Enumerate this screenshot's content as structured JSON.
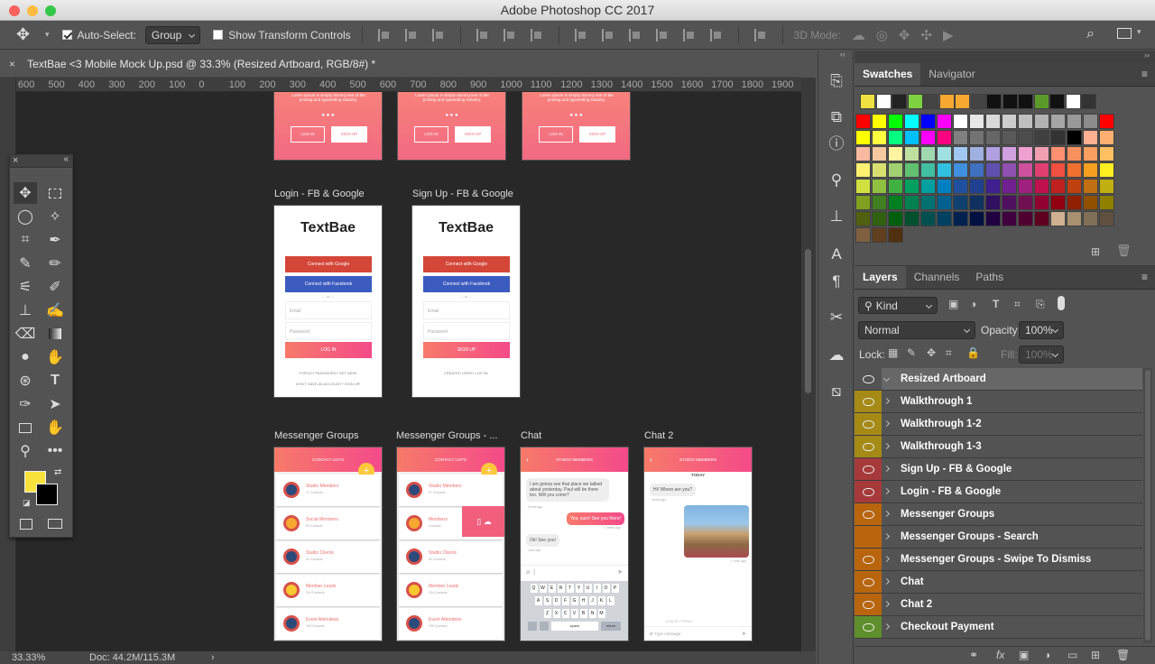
{
  "window": {
    "title": "Adobe Photoshop CC 2017"
  },
  "options_bar": {
    "auto_select_label": "Auto-Select:",
    "auto_select_value": "Group",
    "show_transform_label": "Show Transform Controls",
    "mode_3d_label": "3D Mode:"
  },
  "document": {
    "tab_title": "TextBae <3 Mobile Mock Up.psd @ 33.3% (Resized Artboard, RGB/8#) *",
    "close": "×"
  },
  "ruler": {
    "ticks": [
      "600",
      "500",
      "400",
      "300",
      "200",
      "100",
      "0",
      "100",
      "200",
      "300",
      "400",
      "500",
      "600",
      "700",
      "800",
      "900",
      "1000",
      "1100",
      "1200",
      "1300",
      "1400",
      "1500",
      "1600",
      "1700",
      "1800",
      "1900"
    ]
  },
  "status": {
    "zoom": "33.33%",
    "doc": "Doc: 44.2M/115.3M"
  },
  "artboards": {
    "top_row": [
      {
        "text": "Lorem Ipsum is simply dummy text of the printing and typesetting industry.",
        "login": "LOG IN",
        "signup": "SIGN UP"
      },
      {
        "text": "Lorem Ipsum is simply dummy text of the printing and typesetting industry.",
        "login": "LOG IN",
        "signup": "SIGN UP"
      },
      {
        "text": "Lorem Ipsum is simply dummy text of the printing and typesetting industry.",
        "login": "LOG IN",
        "signup": "SIGN UP"
      }
    ],
    "login": {
      "label": "Login - FB & Google",
      "brand": "TextBae",
      "google": "Connect with Google",
      "facebook": "Connect with Facebook",
      "or": "— or —",
      "email": "Email",
      "password": "Password",
      "button": "LOG IN",
      "forgot": "FORGOT PASSWORD? GET NEW!",
      "noacct": "DON'T HAVE AN ACCOUNT? SIGN UP!"
    },
    "signup": {
      "label": "Sign Up - FB & Google",
      "brand": "TextBae",
      "google": "Connect with Google",
      "facebook": "Connect with Facebook",
      "or": "— or —",
      "email": "Email",
      "password": "Password",
      "button": "SIGN UP",
      "have": "CREATED USER? LOG IN!"
    },
    "messenger": {
      "label": "Messenger Groups",
      "header": "CONTACT LISTS",
      "items": [
        {
          "name": "Studio Members",
          "sub": "47 Contacts"
        },
        {
          "name": "Social Members",
          "sub": "53 Contacts"
        },
        {
          "name": "Studio Clients",
          "sub": "62 Contacts"
        },
        {
          "name": "Member Leads",
          "sub": "204 Contacts"
        },
        {
          "name": "Event Attendees",
          "sub": "295 Contacts"
        }
      ]
    },
    "messenger2": {
      "label": "Messenger Groups - ...",
      "header": "CONTACT LISTS",
      "items": [
        {
          "name": "Studio Members",
          "sub": "47 Contacts"
        },
        {
          "name": "Members",
          "sub": "Contacts"
        },
        {
          "name": "Studio Clients",
          "sub": "62 Contacts"
        },
        {
          "name": "Member Leads",
          "sub": "204 Contacts"
        },
        {
          "name": "Event Attendees",
          "sub": "295 Contacts"
        }
      ]
    },
    "chat": {
      "label": "Chat",
      "header": "STUDIO MEMBERS",
      "m1": "I am gonna see that place we talked about yesterday. Paul will be there too. Will you come?",
      "m1_time": "2mins ago",
      "m2": "Yes, sure! See you there!",
      "m2_time": "✓ 2mins ago",
      "m3": "Ok! See you!",
      "m3_time": "1min ago",
      "kb_row1": "QWERTYUIOP",
      "kb_row2": "ASDFGHJKL",
      "kb_row3": "ZXCVBNM",
      "space": "space",
      "return": "return"
    },
    "chat2": {
      "label": "Chat 2",
      "header": "STUDIO MEMBERS",
      "today": "TODAY",
      "m1": "Hi! Where are you?",
      "m1_time": "3mins ago",
      "photo_time": "✓ 1min ago",
      "typing": "LISA IS TYPING",
      "input": "Type message"
    }
  },
  "swatches_panel": {
    "tabs": [
      "Swatches",
      "Navigator"
    ],
    "recent": [
      "#f0e040",
      "#ffffff",
      "#222222",
      "#7ed140",
      "#444444",
      "#f7a830",
      "#f7a830",
      "#444444",
      "#111111",
      "#111111",
      "#111111",
      "#5a9a2a",
      "#111111",
      "#ffffff",
      "#333333"
    ],
    "rows": [
      [
        "#ff0000",
        "#ffff00",
        "#00ff00",
        "#00ffff",
        "#0000ff",
        "#ff00ff",
        "#ffffff",
        "#e6e6e6",
        "#d9d9d9",
        "#cccccc",
        "#bfbfbf",
        "#b3b3b3",
        "#a6a6a6",
        "#999999",
        "#8c8c8c",
        "#ff0000"
      ],
      [
        "#ffff00",
        "#ffff40",
        "#00ff80",
        "#00c0ff",
        "#ff00ff",
        "#ff0080",
        "#808080",
        "#737373",
        "#666666",
        "#595959",
        "#4d4d4d",
        "#404040",
        "#333333",
        "#000000",
        "#ffb090",
        "#ffb070"
      ],
      [
        "#f9b8a0",
        "#f7c9a0",
        "#fef3a0",
        "#c0e0a0",
        "#a0d8b0",
        "#a0e0e0",
        "#a0c8f0",
        "#a0b0e0",
        "#b0a0e0",
        "#d0a0e0",
        "#f0a0d0",
        "#f0a0b0",
        "#ff9070",
        "#f89060",
        "#f9a060",
        "#fec060"
      ],
      [
        "#fff070",
        "#d8e070",
        "#a0d070",
        "#60c070",
        "#40c0a0",
        "#30c0e0",
        "#4090e0",
        "#4070c0",
        "#6050b0",
        "#9050b0",
        "#d050a0",
        "#e04070",
        "#f05040",
        "#f07030",
        "#f7a020",
        "#ffef20"
      ],
      [
        "#d0e040",
        "#90c040",
        "#40b040",
        "#00a060",
        "#00a0a0",
        "#0080c0",
        "#2050a0",
        "#204090",
        "#402090",
        "#702090",
        "#a02080",
        "#c01050",
        "#c02020",
        "#c04010",
        "#c07010",
        "#c0b010"
      ],
      [
        "#80a020",
        "#408020",
        "#008020",
        "#008050",
        "#007070",
        "#006090",
        "#104070",
        "#103060",
        "#301060",
        "#501060",
        "#701050",
        "#900030",
        "#900010",
        "#902000",
        "#905000",
        "#908000"
      ],
      [
        "#506010",
        "#306010",
        "#006010",
        "#005030",
        "#005050",
        "#004060",
        "#002050",
        "#001040",
        "#200040",
        "#400040",
        "#500030",
        "#600020",
        "#d0b090",
        "#a89070",
        "#807058",
        "#605040"
      ],
      [
        "#806040",
        "#604020",
        "#503010"
      ]
    ]
  },
  "layers_panel": {
    "tabs": [
      "Layers",
      "Channels",
      "Paths"
    ],
    "kind": "Kind",
    "blend": "Normal",
    "opacity_label": "Opacity:",
    "opacity": "100%",
    "lock_label": "Lock:",
    "fill_label": "Fill:",
    "fill": "100%",
    "layers": [
      {
        "name": "Resized Artboard",
        "color": "#535353",
        "visible": true,
        "expanded": true
      },
      {
        "name": "Walkthrough 1",
        "color": "#a58a16",
        "visible": true
      },
      {
        "name": "Walkthrough 1-2",
        "color": "#a58a16",
        "visible": true
      },
      {
        "name": "Walkthrough 1-3",
        "color": "#a58a16",
        "visible": true
      },
      {
        "name": "Sign Up - FB & Google",
        "color": "#a63a3a",
        "visible": true
      },
      {
        "name": "Login - FB & Google",
        "color": "#a63a3a",
        "visible": true
      },
      {
        "name": "Messenger Groups",
        "color": "#b8650e",
        "visible": true
      },
      {
        "name": "Messenger Groups - Search",
        "color": "#b8650e",
        "visible": false
      },
      {
        "name": "Messenger Groups - Swipe To Dismiss",
        "color": "#b8650e",
        "visible": true
      },
      {
        "name": "Chat",
        "color": "#b8650e",
        "visible": true
      },
      {
        "name": "Chat 2",
        "color": "#b8650e",
        "visible": true
      },
      {
        "name": "Checkout Payment",
        "color": "#5e8f2c",
        "visible": true
      }
    ]
  }
}
